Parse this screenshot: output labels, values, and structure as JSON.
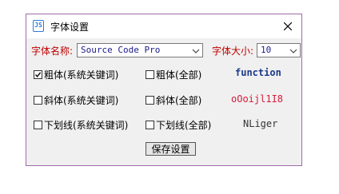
{
  "window": {
    "title": "字体设置",
    "icon_text": "JS"
  },
  "font_name": {
    "label": "字体名称:",
    "value": "Source Code Pro"
  },
  "font_size": {
    "label": "字体大小:",
    "value": "10"
  },
  "options": [
    {
      "label": "粗体(系统关键词)",
      "checked": true
    },
    {
      "label": "粗体(全部)",
      "checked": false
    },
    {
      "label": "斜体(系统关键词)",
      "checked": false
    },
    {
      "label": "斜体(全部)",
      "checked": false
    },
    {
      "label": "下划线(系统关键词)",
      "checked": false
    },
    {
      "label": "下划线(全部)",
      "checked": false
    }
  ],
  "preview": {
    "keyword": "function",
    "sample": "oOoijl1I8",
    "name": "NLiger"
  },
  "save_label": "保存设置",
  "colors": {
    "border": "#a06aa8",
    "label_red": "#c00000",
    "keyword_blue": "#1c3a8a",
    "sample_red": "#d81b3b",
    "name_gray": "#333333"
  }
}
